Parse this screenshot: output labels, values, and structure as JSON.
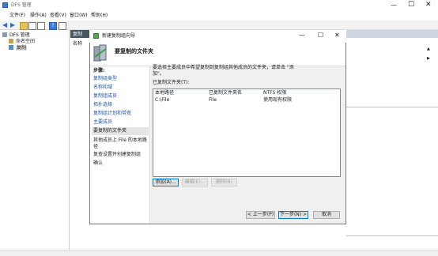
{
  "window": {
    "title": "DFS 管理"
  },
  "menu": [
    "文件(F)",
    "操作(A)",
    "查看(V)",
    "窗口(W)",
    "帮助(H)"
  ],
  "tree": {
    "root": "DFS 管理",
    "items": [
      "命名空间",
      "复制"
    ]
  },
  "middle_pane": {
    "header": "复制",
    "col_name": "名称"
  },
  "dialog": {
    "title": "新建复制组向导",
    "heading": "要复制的文件夹",
    "steps_header": "步骤:",
    "steps": [
      "复制组类型",
      "名称和域",
      "复制组成员",
      "拓扑选择",
      "复制组计划和带宽",
      "主要成员",
      "要复制的文件夹",
      "其他成员上 File 的本地路径",
      "复查设置并创建复制组",
      "确认"
    ],
    "active_step_index": 6,
    "instruction": "要选择主要成员中希望复制到复制组其他成员的文件夹，请单击 \"添加\"。",
    "list_label": "已复制文件夹(T):",
    "columns": [
      "本地路径",
      "已复制文件夹名",
      "NTFS 权限"
    ],
    "rows": [
      {
        "path": "C:\\File",
        "name": "File",
        "perm": "使用现有权限"
      }
    ],
    "add_button": "添加(A)...",
    "edit_button": "编辑(E)...",
    "remove_button": "删除(R)",
    "back_button": "< 上一步(P)",
    "next_button": "下一步(N) >",
    "cancel_button": "取消"
  },
  "colors": {
    "step_link": "#1b55b4",
    "active_step_bg": "#e5e5e5",
    "dark_header": "#4a5663"
  }
}
